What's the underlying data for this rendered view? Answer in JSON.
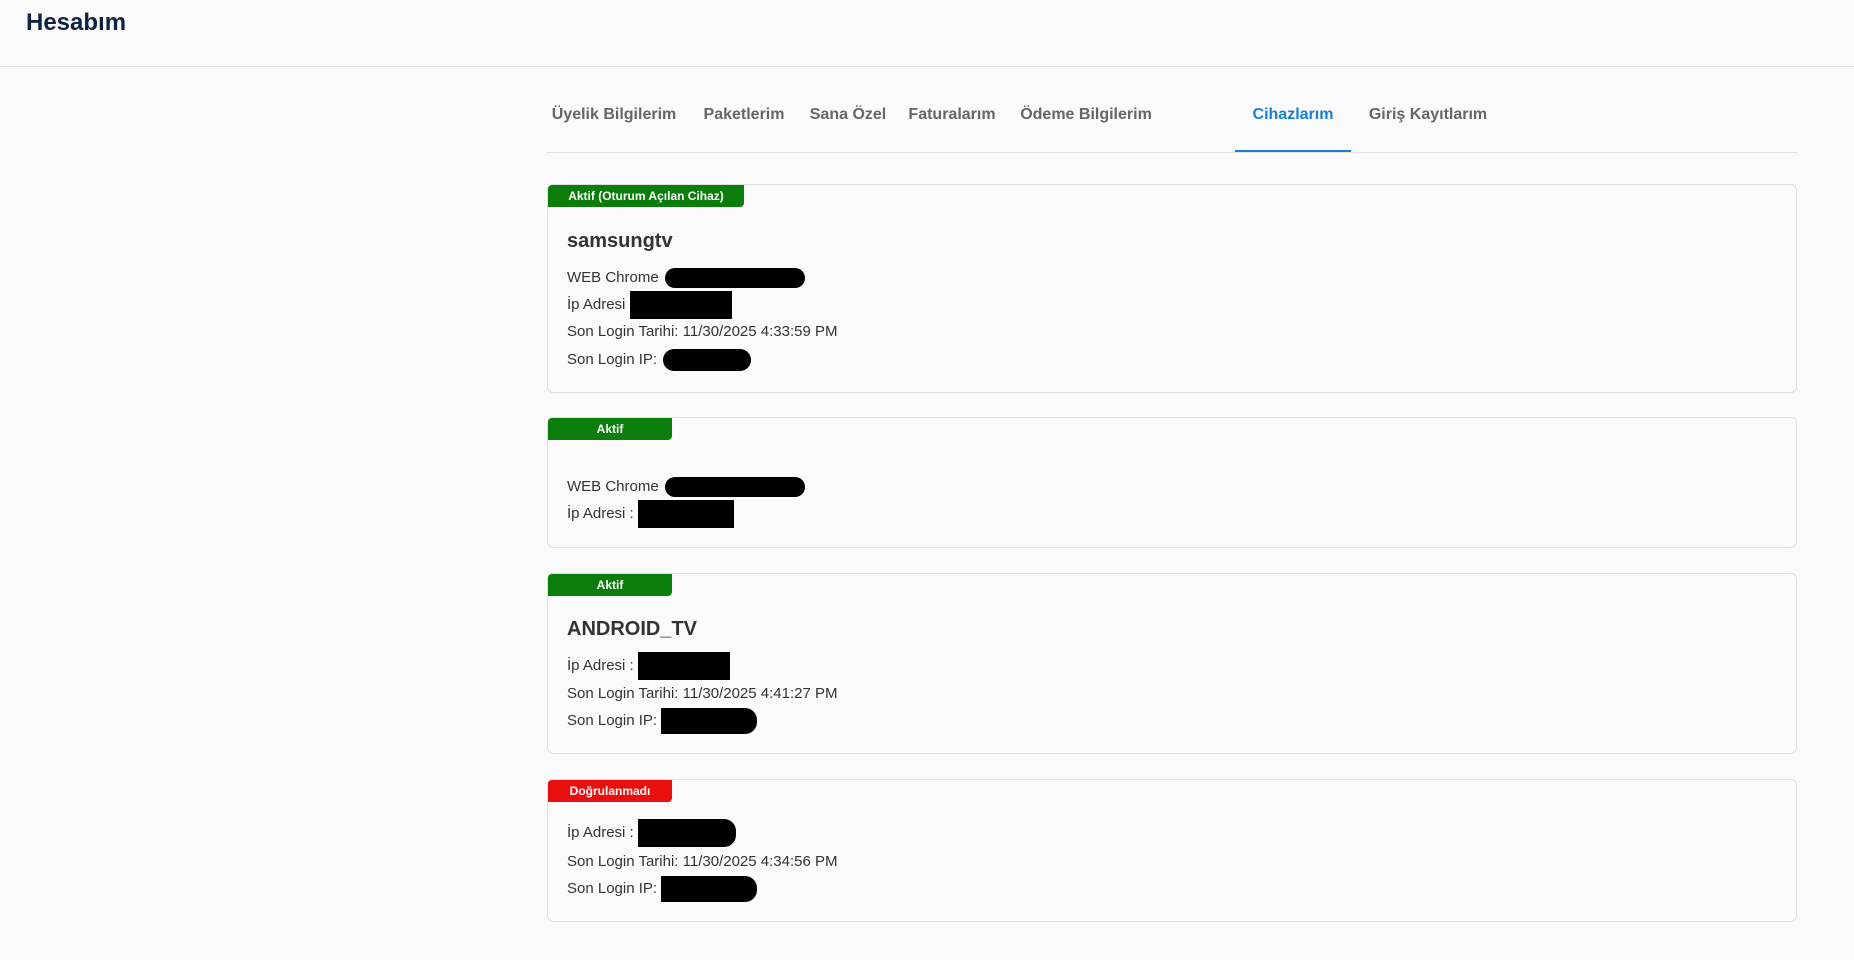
{
  "header": {
    "title": "Hesabım"
  },
  "tabs": [
    {
      "label": "Üyelik Bilgilerim",
      "active": false
    },
    {
      "label": "Paketlerim",
      "active": false
    },
    {
      "label": "Sana Özel",
      "active": false
    },
    {
      "label": "Faturalarım",
      "active": false
    },
    {
      "label": "Ödeme Bilgilerim",
      "active": false
    },
    {
      "label": "Cihazlarım",
      "active": true
    },
    {
      "label": "Giriş Kayıtlarım",
      "active": false
    }
  ],
  "colors": {
    "accent": "#1a7fd4",
    "active_badge": "#0a7d0a",
    "unverified_badge": "#ea0f0f"
  },
  "devices": [
    {
      "status": "Aktif (Oturum Açılan Cihaz)",
      "name": "samsungtv",
      "browser_label": "WEB Chrome",
      "ip_label": "İp Adresi",
      "last_login_date_label": "Son Login Tarihi: 11/30/2025 4:33:59 PM",
      "last_login_ip_label": "Son Login IP:"
    },
    {
      "status": "Aktif",
      "browser_label": "WEB Chrome",
      "ip_label": "İp Adresi :"
    },
    {
      "status": "Aktif",
      "name": "ANDROID_TV",
      "ip_label": "İp Adresi :",
      "last_login_date_label": "Son Login Tarihi: 11/30/2025 4:41:27 PM",
      "last_login_ip_label": "Son Login IP:"
    },
    {
      "status": "Doğrulanmadı",
      "ip_label": "İp Adresi :",
      "last_login_date_label": "Son Login Tarihi: 11/30/2025 4:34:56 PM",
      "last_login_ip_label": "Son Login IP:"
    }
  ]
}
